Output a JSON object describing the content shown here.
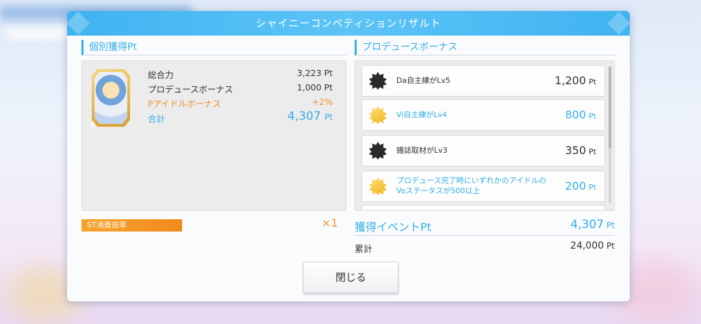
{
  "dialog": {
    "title": "シャイニーコンペティションリザルト",
    "close_label": "閉じる"
  },
  "individual": {
    "header": "個別獲得Pt",
    "rows": [
      {
        "label": "総合力",
        "value": "3,223 Pt"
      },
      {
        "label": "プロデュースボーナス",
        "value": "1,000 Pt"
      },
      {
        "label": "Pアイドルボーナス",
        "value": "+2%"
      }
    ],
    "total_label": "合計",
    "total_value": "4,307",
    "total_unit": "Pt"
  },
  "produce_bonus": {
    "header": "プロデュースボーナス",
    "items": [
      {
        "name": "Da自主練がLv5",
        "value": "1,200",
        "unit": "Pt",
        "badge": "dark-star-icon"
      },
      {
        "name": "Vi自主練がLv4",
        "value": "800",
        "unit": "Pt",
        "badge": "gold-star-icon"
      },
      {
        "name": "雑誌取材がLv3",
        "value": "350",
        "unit": "Pt",
        "badge": "dark-star-icon"
      },
      {
        "name": "プロデュース完了時にいずれかのアイドルの",
        "name2": "Voステータスが500以上",
        "value": "200",
        "unit": "Pt",
        "badge": "gold-star-icon"
      }
    ]
  },
  "st": {
    "label": "ST消費倍率",
    "multiplier": "×1"
  },
  "event": {
    "label": "獲得イベントPt",
    "value": "4,307",
    "unit": "Pt",
    "cumulative_label": "累計",
    "cumulative_value": "24,000",
    "cumulative_unit": "Pt"
  },
  "colors": {
    "accent": "#33aee6",
    "orange": "#f0902a"
  }
}
